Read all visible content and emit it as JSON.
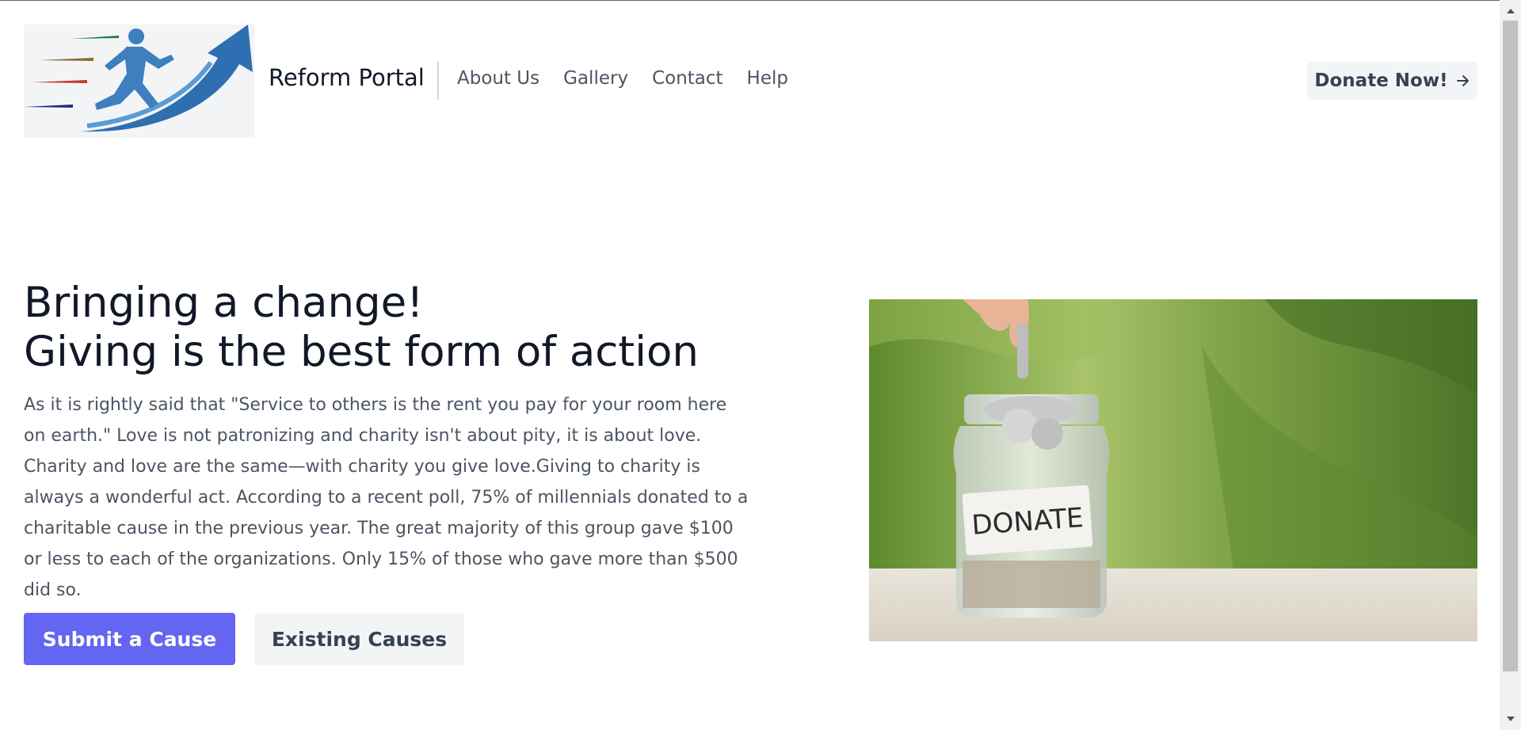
{
  "header": {
    "brand": "Reform Portal",
    "nav": [
      "About Us",
      "Gallery",
      "Contact",
      "Help"
    ],
    "donate_label": "Donate Now!",
    "donate_icon": "arrow-right-icon"
  },
  "hero": {
    "title_line1": "Bringing a change!",
    "title_line2": "Giving is the best form of action",
    "paragraph": "As it is rightly said that \"Service to others is the rent you pay for your room here on earth.\" Love is not patronizing and charity isn't about pity, it is about love. Charity and love are the same—with charity you give love.Giving to charity is always a wonderful act. According to a recent poll, 75% of millennials donated to a charitable cause in the previous year. The great majority of this group gave $100 or less to each of the organizations. Only 15% of those who gave more than $500 did so.",
    "primary_button": "Submit a Cause",
    "secondary_button": "Existing Causes",
    "image_label": "DONATE"
  },
  "colors": {
    "accent": "#6366f1",
    "text_dark": "#111827",
    "text_muted": "#4b5563",
    "button_light": "#f3f4f6"
  }
}
